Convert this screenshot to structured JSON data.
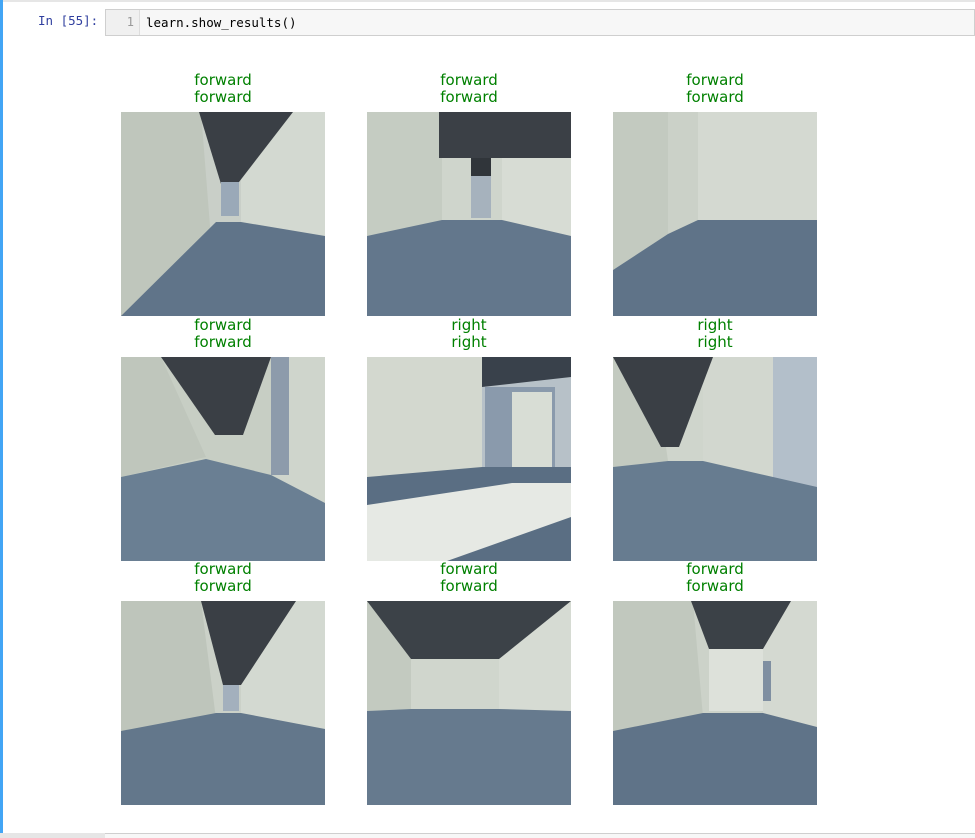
{
  "cell": {
    "prompt": "In [55]:",
    "line_number": "1",
    "code": "learn.show_results()"
  },
  "results": [
    {
      "actual": "forward",
      "predicted": "forward",
      "scene": "corridor-left-slab"
    },
    {
      "actual": "forward",
      "predicted": "forward",
      "scene": "corridor-door-ahead"
    },
    {
      "actual": "forward",
      "predicted": "forward",
      "scene": "corner-open-floor"
    },
    {
      "actual": "forward",
      "predicted": "forward",
      "scene": "corridor-beams"
    },
    {
      "actual": "right",
      "predicted": "right",
      "scene": "turn-right-pillar"
    },
    {
      "actual": "right",
      "predicted": "right",
      "scene": "long-corridor-beams"
    },
    {
      "actual": "forward",
      "predicted": "forward",
      "scene": "corridor-left-slab-2"
    },
    {
      "actual": "forward",
      "predicted": "forward",
      "scene": "room-ceiling"
    },
    {
      "actual": "forward",
      "predicted": "forward",
      "scene": "corridor-right-slab"
    }
  ],
  "colors": {
    "title_correct": "#008000",
    "prompt": "#303f9f",
    "selected_cell_bar": "#42a5f5"
  }
}
